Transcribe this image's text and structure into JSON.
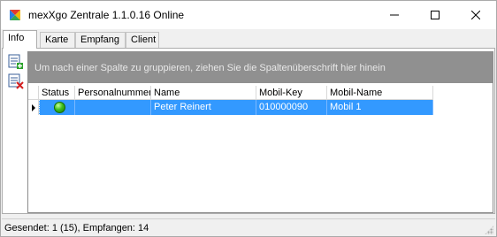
{
  "window": {
    "title": "mexXgo Zentrale 1.1.0.16 Online",
    "icon": "app-logo-icon"
  },
  "tabs": [
    {
      "label": "Info",
      "active": true
    },
    {
      "label": "Karte",
      "active": false
    },
    {
      "label": "Empfang",
      "active": false
    },
    {
      "label": "Client",
      "active": false
    }
  ],
  "toolbar": {
    "add_icon": "add-record-icon",
    "delete_icon": "delete-record-icon"
  },
  "grid": {
    "group_hint": "Um nach einer Spalte zu gruppieren, ziehen Sie die Spaltenüberschrift hier hinein",
    "columns": [
      "Status",
      "Personalnummer",
      "Name",
      "Mobil-Key",
      "Mobil-Name"
    ],
    "rows": [
      {
        "status": "online",
        "personalnummer": "",
        "name": "Peter Reinert",
        "mobil_key": "010000090",
        "mobil_name": "Mobil 1",
        "selected": true
      }
    ]
  },
  "statusbar": {
    "text": "Gesendet: 1 (15), Empfangen: 14"
  },
  "colors": {
    "selection": "#3399ff",
    "group_bar": "#909090",
    "status_online": "#3fbf1f"
  }
}
